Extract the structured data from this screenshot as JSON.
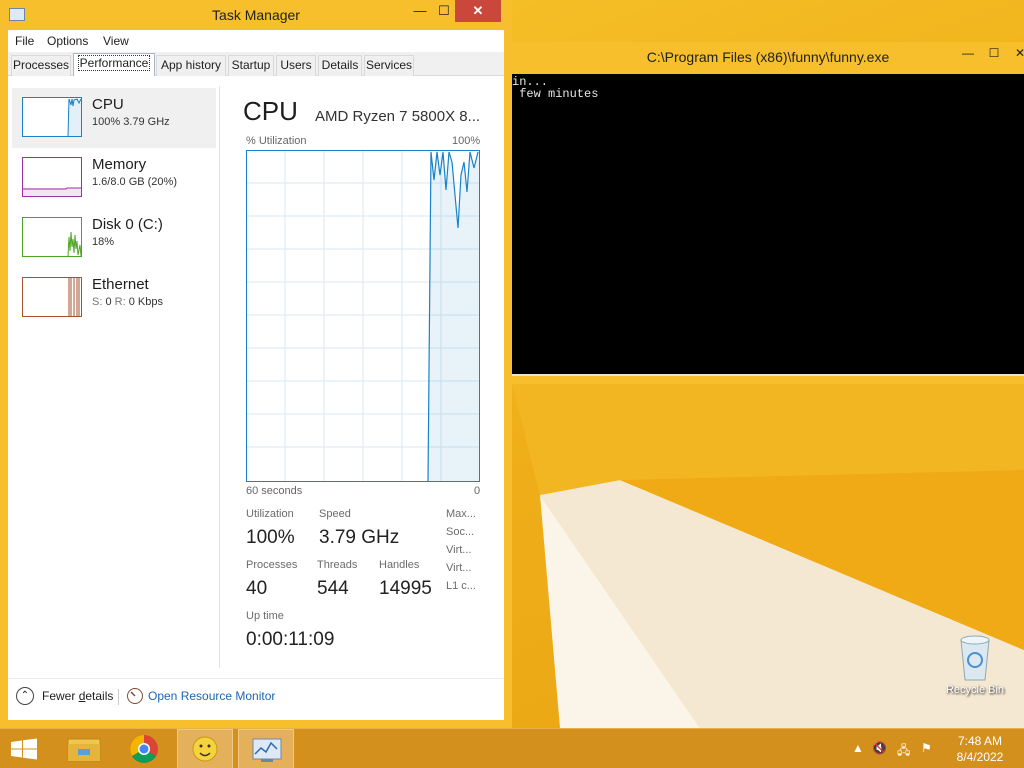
{
  "taskmgr": {
    "title": "Task Manager",
    "controls": {
      "minimize": "—",
      "maximize": "☐",
      "close": "✕"
    },
    "menu": [
      "File",
      "Options",
      "View"
    ],
    "tabs": [
      "Processes",
      "Performance",
      "App history",
      "Startup",
      "Users",
      "Details",
      "Services"
    ],
    "active_tab": "Performance",
    "sidebar": [
      {
        "name": "CPU",
        "value": "100%  3.79 GHz",
        "color": "#1a82c8"
      },
      {
        "name": "Memory",
        "value": "1.6/8.0 GB (20%)",
        "color": "#9c2fa5"
      },
      {
        "name": "Disk 0 (C:)",
        "value": "18%",
        "color": "#4da520"
      },
      {
        "name": "Ethernet",
        "value_s_label": "S:",
        "value_s": "0",
        "value_r_label": "R:",
        "value_r": "0 Kbps",
        "color": "#a3522b"
      }
    ],
    "main": {
      "title": "CPU",
      "model": "AMD Ryzen 7 5800X 8...",
      "utilization_label": "% Utilization",
      "max_label": "100%",
      "time_label": "60 seconds",
      "zero_label": "0",
      "stats": {
        "utilization_label": "Utilization",
        "utilization": "100%",
        "speed_label": "Speed",
        "speed": "3.79 GHz",
        "processes_label": "Processes",
        "processes": "40",
        "threads_label": "Threads",
        "threads": "544",
        "handles_label": "Handles",
        "handles": "14995",
        "uptime_label": "Up time",
        "uptime": "0:00:11:09"
      },
      "side_labels": [
        "Max...",
        "Soc...",
        "Virt...",
        "Virt...",
        "L1 c..."
      ]
    },
    "footer": {
      "fewer_prefix": "Fewer ",
      "fewer_underlined": "d",
      "fewer_suffix": "etails",
      "resource_monitor": "Open Resource Monitor"
    }
  },
  "console": {
    "title": "C:\\Program Files (x86)\\funny\\funny.exe",
    "lines": [
      "in...",
      " few minutes"
    ]
  },
  "desktop": {
    "recycle_bin": "Recycle Bin"
  },
  "taskbar": {
    "clock_time": "7:48 AM",
    "clock_date": "8/4/2022",
    "apps": [
      "start-button",
      "file-explorer",
      "chrome",
      "funny-app",
      "task-manager"
    ]
  }
}
